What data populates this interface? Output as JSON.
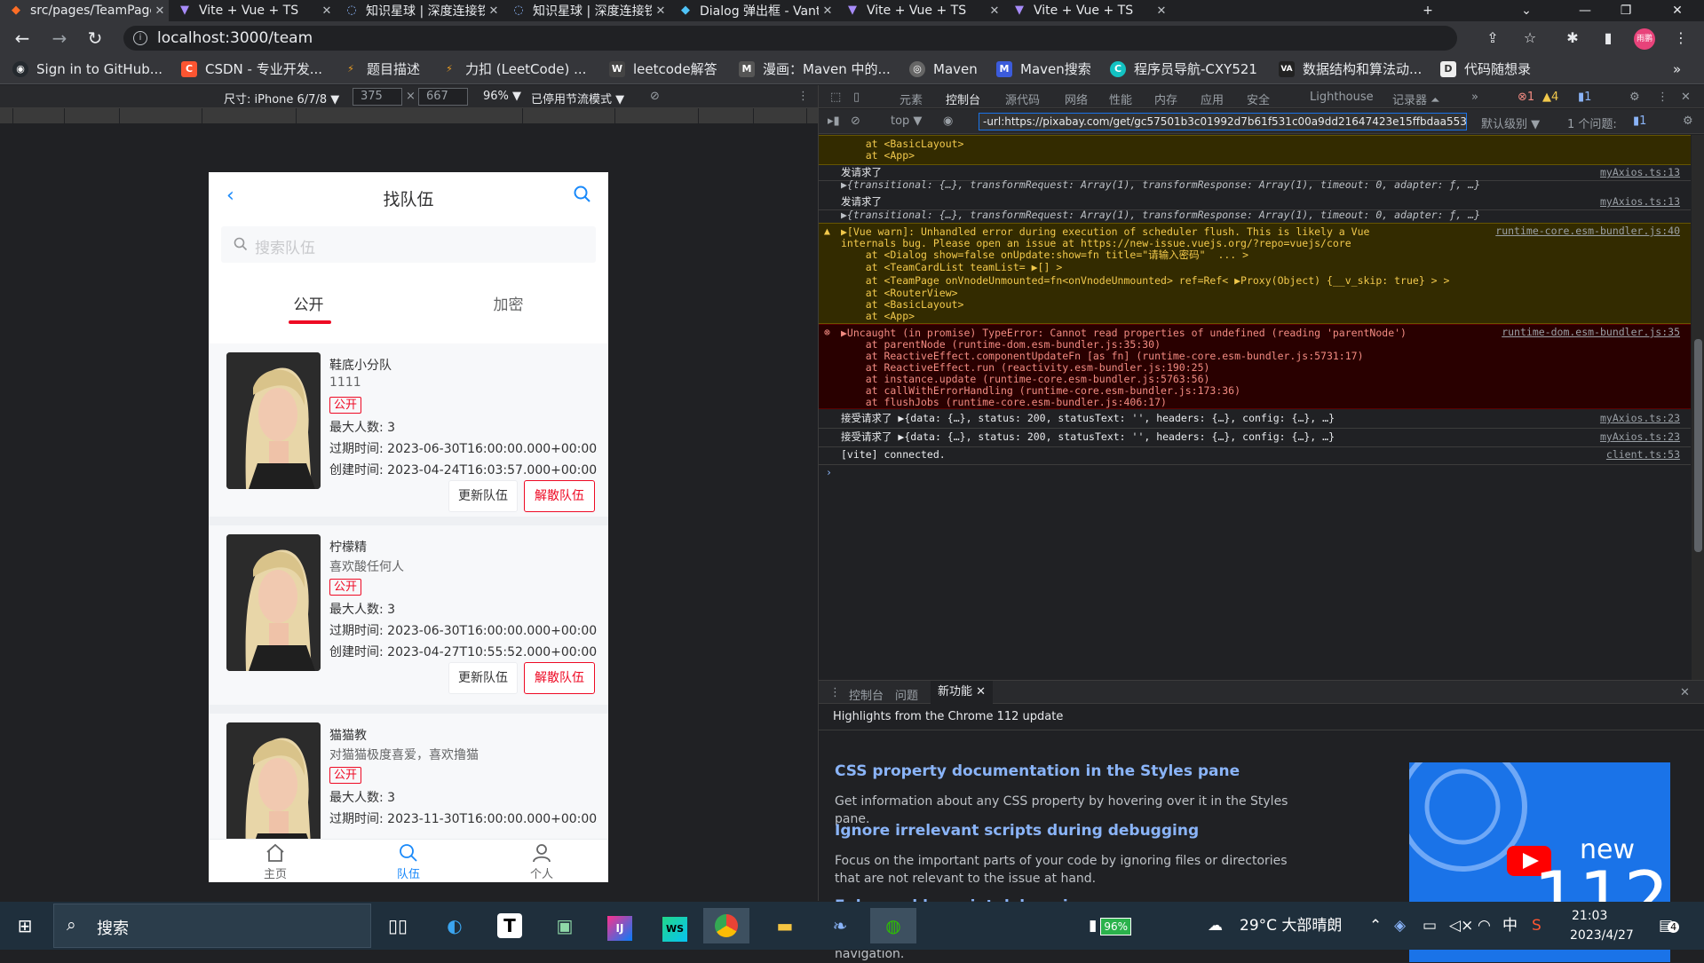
{
  "tabs": [
    {
      "title": "src/pages/TeamPage",
      "icon": "gitlab-icon"
    },
    {
      "title": "Vite + Vue + TS",
      "icon": "vite-icon"
    },
    {
      "title": "知识星球 | 深度连接铁",
      "icon": "loading-icon"
    },
    {
      "title": "知识星球 | 深度连接铁",
      "icon": "loading-icon"
    },
    {
      "title": "Dialog 弹出框 - Vant",
      "icon": "vant-icon"
    },
    {
      "title": "Vite + Vue + TS",
      "icon": "vite-icon"
    },
    {
      "title": "Vite + Vue + TS",
      "icon": "vite-icon"
    }
  ],
  "address": {
    "url": "localhost:3000/team"
  },
  "profile": {
    "label": "雨鹏"
  },
  "bookmarks": [
    {
      "label": "Sign in to GitHub...",
      "color": "#24292e",
      "glyph": "G"
    },
    {
      "label": "CSDN - 专业开发...",
      "color": "#fc5531",
      "glyph": "C"
    },
    {
      "label": "题目描述",
      "color": "#f0a020",
      "glyph": "L"
    },
    {
      "label": "力扣 (LeetCode) ...",
      "color": "#f0a020",
      "glyph": "L"
    },
    {
      "label": "leetcode解答",
      "color": "#444",
      "glyph": "W"
    },
    {
      "label": "漫画：Maven 中的...",
      "color": "#555",
      "glyph": "M"
    },
    {
      "label": "Maven",
      "color": "#666",
      "glyph": "M"
    },
    {
      "label": "Maven搜索",
      "color": "#3b5bdb",
      "glyph": "M"
    },
    {
      "label": "程序员导航-CXY521",
      "color": "#13c2c2",
      "glyph": "C"
    },
    {
      "label": "数据结构和算法动...",
      "color": "#222",
      "glyph": "VA"
    },
    {
      "label": "代码随想录",
      "color": "#333",
      "glyph": "D"
    }
  ],
  "device": {
    "label": "尺寸: iPhone 6/7/8 ▼",
    "width": "375",
    "height": "667",
    "zoom": "96% ▼",
    "throttle": "已停用节流模式 ▼"
  },
  "app": {
    "title": "找队伍",
    "search_placeholder": "搜索队伍",
    "tab_public": "公开",
    "tab_secret": "加密",
    "teams": [
      {
        "name": "鞋底小分队",
        "desc": "1111",
        "status": "公开",
        "max": "最大人数: 3",
        "expire": "过期时间: 2023-06-30T16:00:00.000+00:00",
        "created": "创建时间: 2023-04-24T16:03:57.000+00:00",
        "update_btn": "更新队伍",
        "quit_btn": "解散队伍"
      },
      {
        "name": "柠檬精",
        "desc": "喜欢酸任何人",
        "status": "公开",
        "max": "最大人数: 3",
        "expire": "过期时间: 2023-06-30T16:00:00.000+00:00",
        "created": "创建时间: 2023-04-27T10:55:52.000+00:00",
        "update_btn": "更新队伍",
        "quit_btn": "解散队伍"
      },
      {
        "name": "猫猫教",
        "desc": "对猫猫极度喜爱，喜欢撸猫",
        "status": "公开",
        "max": "最大人数: 3",
        "expire": "过期时间: 2023-11-30T16:00:00.000+00:00"
      }
    ],
    "tabbar": [
      {
        "label": "主页",
        "icon": "home-icon"
      },
      {
        "label": "队伍",
        "icon": "search-icon"
      },
      {
        "label": "个人",
        "icon": "user-icon"
      }
    ]
  },
  "devtools": {
    "tabs": [
      "元素",
      "控制台",
      "源代码",
      "网络",
      "性能",
      "内存",
      "应用",
      "安全",
      "Lighthouse",
      "记录器 ⏶"
    ],
    "active_tab": "控制台",
    "badges": {
      "errors": "1",
      "warnings": "4",
      "issues": "1"
    },
    "filter": {
      "context": "top ▼",
      "value": "-url:https://pixabay.com/get/gc57501b3c01992d7b61f531c00a9dd21647423e15ffbdaa553",
      "level": "默认级别 ▼",
      "issues": "1 个问题: ",
      "issue_count": "1"
    },
    "console": [
      {
        "text": "    at <BasicLayout>",
        "type": "warn"
      },
      {
        "text": "    at <App>",
        "type": "warn"
      },
      {
        "text": "发请求了",
        "src": "myAxios.ts:13",
        "type": "plain"
      },
      {
        "text": "▶{transitional: {…}, transformRequest: Array(1), transformResponse: Array(1), timeout: 0, adapter: ƒ, …}",
        "type": "obj"
      },
      {
        "text": "发请求了",
        "src": "myAxios.ts:13",
        "type": "plain"
      },
      {
        "text": "▶{transitional: {…}, transformRequest: Array(1), transformResponse: Array(1), timeout: 0, adapter: ƒ, …}",
        "type": "obj"
      },
      {
        "text": "▶[Vue warn]: Unhandled error during execution of scheduler flush. This is likely a Vue",
        "src": "runtime-core.esm-bundler.js:40",
        "type": "warn"
      },
      {
        "text": "internals bug. Please open an issue at https://new-issue.vuejs.org/?repo=vuejs/core",
        "type": "warn"
      },
      {
        "text": "    at <Dialog show=false onUpdate:show=fn title=\"请输入密码\"  ... >",
        "type": "warn"
      },
      {
        "text": "    at <TeamCardList teamList= ▶[] >",
        "type": "warn"
      },
      {
        "text": "    at <TeamPage onVnodeUnmounted=fn<onVnodeUnmounted> ref=Ref< ▶Proxy(Object) {__v_skip: true} > >",
        "type": "warn"
      },
      {
        "text": "    at <RouterView>",
        "type": "warn"
      },
      {
        "text": "    at <BasicLayout>",
        "type": "warn"
      },
      {
        "text": "    at <App>",
        "type": "warn"
      },
      {
        "text": "▶Uncaught (in promise) TypeError: Cannot read properties of undefined (reading 'parentNode')",
        "src": "runtime-dom.esm-bundler.js:35",
        "type": "err"
      },
      {
        "text": "    at parentNode (runtime-dom.esm-bundler.js:35:30)",
        "type": "err"
      },
      {
        "text": "    at ReactiveEffect.componentUpdateFn [as fn] (runtime-core.esm-bundler.js:5731:17)",
        "type": "err"
      },
      {
        "text": "    at ReactiveEffect.run (reactivity.esm-bundler.js:190:25)",
        "type": "err"
      },
      {
        "text": "    at instance.update (runtime-core.esm-bundler.js:5763:56)",
        "type": "err"
      },
      {
        "text": "    at callWithErrorHandling (runtime-core.esm-bundler.js:173:36)",
        "type": "err"
      },
      {
        "text": "    at flushJobs (runtime-core.esm-bundler.js:406:17)",
        "type": "err"
      },
      {
        "text": "接受请求了 ▶{data: {…}, status: 200, statusText: '', headers: {…}, config: {…}, …}",
        "src": "myAxios.ts:23",
        "type": "plain"
      },
      {
        "text": "接受请求了 ▶{data: {…}, status: 200, statusText: '', headers: {…}, config: {…}, …}",
        "src": "myAxios.ts:23",
        "type": "plain"
      },
      {
        "text": "[vite] connected.",
        "src": "client.ts:53",
        "type": "plain"
      },
      {
        "text": "›",
        "type": "prompt"
      }
    ],
    "drawer": {
      "tabs": [
        "控制台",
        "问题",
        "新功能"
      ],
      "highlight": "Highlights from the Chrome 112 update",
      "features": [
        {
          "title": "CSS property documentation in the Styles pane",
          "desc": "Get information about any CSS property by hovering over it in the Styles pane."
        },
        {
          "title": "Ignore irrelevant scripts during debugging",
          "desc": "Focus on the important parts of your code by ignoring files or directories that are not relevant to the issue at hand."
        },
        {
          "title": "Enhanced logpoint debugging",
          "desc": "Jump directly to the logpoint location from the Console for quicker code navigation."
        }
      ],
      "badge_new": "new",
      "badge_ver": "112"
    }
  },
  "taskbar": {
    "search": "搜索",
    "battery": "96%",
    "weather": "29°C 大部晴朗",
    "ime": "中",
    "time": "21:03",
    "date": "2023/4/27",
    "notify": "4"
  }
}
